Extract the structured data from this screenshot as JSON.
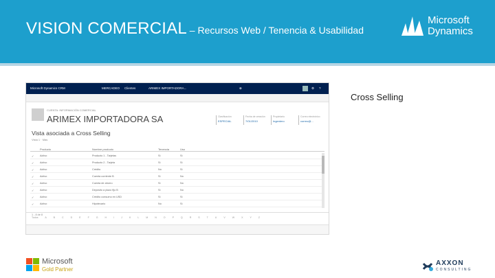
{
  "header": {
    "title_main": "VISION COMERCIAL",
    "title_sub": " – Recursos Web / Tenencia & Usabilidad",
    "logo_line1": "Microsoft",
    "logo_line2": "Dynamics"
  },
  "screenshot": {
    "topbar": {
      "app": "Microsoft Dynamics CRM",
      "area": "MERCADEO",
      "entity": "Clientes",
      "record": "ARIMEX IMPORTADORA..."
    },
    "record": {
      "label": "CUENTA: INFORMACIÓN COMERCIAL",
      "name": "ARIMEX IMPORTADORA SA"
    },
    "fields": [
      {
        "key": "Clasificación",
        "value": "ESPECIAL"
      },
      {
        "key": "Fecha de creación",
        "value": "7/01/2010"
      },
      {
        "key": "Propietario",
        "value": "Ingeniero"
      },
      {
        "key": "Correo electrónico",
        "value": "correo@..."
      }
    ],
    "view_title": "Vista asociada a Cross Selling",
    "view_sub": "Vista 1 · Más",
    "columns": [
      "Producto",
      "Nombre producto",
      "Tenencia",
      "Uso"
    ],
    "rows": [
      [
        "Activo",
        "Producto 1 - Tarjetas",
        "Sí",
        "Sí"
      ],
      [
        "Activo",
        "Producto 2 - Tarjeta",
        "Sí",
        "Sí"
      ],
      [
        "Activo",
        "Crédito",
        "No",
        "Sí"
      ],
      [
        "Activo",
        "Cuenta corriente B",
        "Sí",
        "No"
      ],
      [
        "Activo",
        "Cuenta de ahorro",
        "Sí",
        "No"
      ],
      [
        "Activo",
        "Depósito a plazo fijo B",
        "Sí",
        "No"
      ],
      [
        "Activo",
        "Crédito consumo en USD",
        "Sí",
        "Sí"
      ],
      [
        "Activo",
        "Hipotecario",
        "No",
        "Sí"
      ]
    ],
    "alphabet": "Todos A B C D E F G H I J K L M N O P Q R S T U V W X Y Z",
    "footer": "1 - 8 de 8"
  },
  "caption": "Cross Selling",
  "footer_logos": {
    "gold_line1": "Microsoft",
    "gold_line2": "Gold Partner",
    "axxon_line1": "AXXON",
    "axxon_line2": "CONSULTING"
  },
  "colors": {
    "banner": "#1d9fcd",
    "crm_nav": "#002050"
  }
}
